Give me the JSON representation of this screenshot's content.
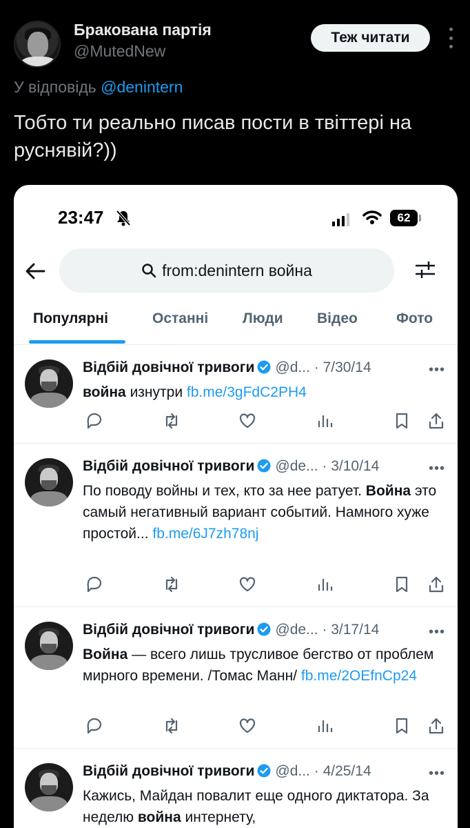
{
  "outer_post": {
    "author_name": "Бракована партія",
    "author_handle": "@MutedNew",
    "follow_label": "Теж читати",
    "reply_prefix": "У відповідь",
    "reply_mention": "@denintern",
    "text": "Тобто ти реально писав пости в твіттері на руснявій?))"
  },
  "screenshot": {
    "status_bar": {
      "time": "23:47",
      "battery": "62"
    },
    "search": {
      "query": "from:denintern война"
    },
    "tabs": [
      {
        "label": "Популярні",
        "active": true
      },
      {
        "label": "Останні",
        "active": false
      },
      {
        "label": "Люди",
        "active": false
      },
      {
        "label": "Відео",
        "active": false
      },
      {
        "label": "Фото",
        "active": false
      }
    ],
    "tweets": [
      {
        "name": "Відбій довічної тривоги",
        "handle": "@d...",
        "date": "7/30/14",
        "body_bold": "война",
        "body_text": " изнутри ",
        "link": "fb.me/3gFdC2PH4"
      },
      {
        "name": "Відбій довічної тривоги",
        "handle": "@de...",
        "date": "3/10/14",
        "body_pre": "По поводу войны и тех, кто за нее ратует. ",
        "body_bold": "Война",
        "body_text": " это самый негативный вариант событий. Намного хуже простой... ",
        "link": "fb.me/6J7zh78nj"
      },
      {
        "name": "Відбій довічної тривоги",
        "handle": "@de...",
        "date": "3/17/14",
        "body_bold": "Война",
        "body_text": " — всего лишь трусливое бегство от проблем мирного времени. /Томас Манн/ ",
        "link": "fb.me/2OEfnCp24"
      },
      {
        "name": "Відбій довічної тривоги",
        "handle": "@d...",
        "date": "4/25/14",
        "body_pre": "Кажись, Майдан повалит еще одного диктатора. За неделю ",
        "body_bold": "война",
        "body_text": " интернету,"
      }
    ]
  }
}
